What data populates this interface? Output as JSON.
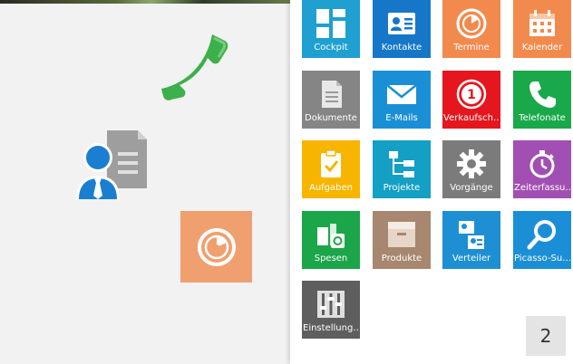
{
  "background": {
    "phone_color": "#3cb04a",
    "orange_tile_color": "#f0a06f"
  },
  "tiles": [
    {
      "label": "Cockpit",
      "color": "#1fa0d0",
      "icon": "dashboard-icon"
    },
    {
      "label": "Kontakte",
      "color": "#1677c9",
      "icon": "contact-card-icon"
    },
    {
      "label": "Termine",
      "color": "#f28a4e",
      "icon": "appointment-dial-icon"
    },
    {
      "label": "Kalender",
      "color": "#f28a4e",
      "icon": "calendar-icon"
    },
    {
      "label": "Dokumente",
      "color": "#858585",
      "icon": "document-icon"
    },
    {
      "label": "E-Mails",
      "color": "#1b8fd6",
      "icon": "envelope-icon"
    },
    {
      "label": "Verkaufsch…",
      "color": "#e5161e",
      "icon": "sales-chance-icon"
    },
    {
      "label": "Telefonate",
      "color": "#19a84a",
      "icon": "phone-icon"
    },
    {
      "label": "Aufgaben",
      "color": "#f7b500",
      "icon": "task-clipboard-icon"
    },
    {
      "label": "Projekte",
      "color": "#149fc4",
      "icon": "project-tree-icon"
    },
    {
      "label": "Vorgänge",
      "color": "#7b7b7b",
      "icon": "gear-icon"
    },
    {
      "label": "Zeiterfassu…",
      "color": "#a24fb3",
      "icon": "stopwatch-icon"
    },
    {
      "label": "Spesen",
      "color": "#1ba64a",
      "icon": "expenses-icon"
    },
    {
      "label": "Produkte",
      "color": "#a88770",
      "icon": "box-icon"
    },
    {
      "label": "Verteiler",
      "color": "#1d8fd2",
      "icon": "distribution-list-icon"
    },
    {
      "label": "Picasso-Su…",
      "color": "#1b8fd6",
      "icon": "search-icon"
    },
    {
      "label": "Einstellung…",
      "color": "#5e5e5e",
      "icon": "settings-sliders-icon"
    }
  ],
  "page_indicator": "2"
}
